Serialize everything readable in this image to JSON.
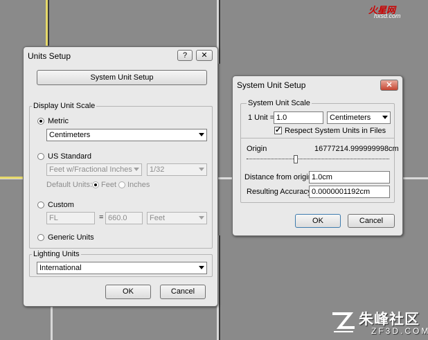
{
  "units_setup": {
    "title": "Units Setup",
    "help_btn": "?",
    "close_btn": "✕",
    "system_unit_setup_btn": "System Unit Setup",
    "display_unit_scale": {
      "label": "Display Unit Scale",
      "metric_label": "Metric",
      "metric_selected": true,
      "metric_value": "Centimeters",
      "us_label": "US Standard",
      "us_value": "Feet w/Fractional Inches",
      "us_fraction": "1/32",
      "default_units_label": "Default Units:",
      "feet_label": "Feet",
      "inches_label": "Inches",
      "custom_label": "Custom",
      "custom_name": "FL",
      "custom_eq": "=",
      "custom_value": "660.0",
      "custom_unit": "Feet",
      "generic_label": "Generic Units"
    },
    "lighting_units": {
      "label": "Lighting Units",
      "value": "International"
    },
    "ok": "OK",
    "cancel": "Cancel"
  },
  "system_unit_setup": {
    "title": "System Unit Setup",
    "close_btn": "✕",
    "scale_group_label": "System Unit Scale",
    "one_unit_label": "1 Unit =",
    "one_unit_value": "1.0",
    "unit_value": "Centimeters",
    "respect_label": "Respect System Units in Files",
    "respect_checked": true,
    "origin_label": "Origin",
    "origin_value": "16777214.999999998cm",
    "distance_label": "Distance from origin:",
    "distance_value": "1.0cm",
    "accuracy_label": "Resulting Accuracy:",
    "accuracy_value": "0.0000001192cm",
    "ok": "OK",
    "cancel": "Cancel"
  },
  "watermarks": {
    "top_main": "火星网",
    "top_sub": "hxsd.com",
    "bottom_main": "朱峰社区",
    "bottom_sub": "ZF3D.COM"
  }
}
